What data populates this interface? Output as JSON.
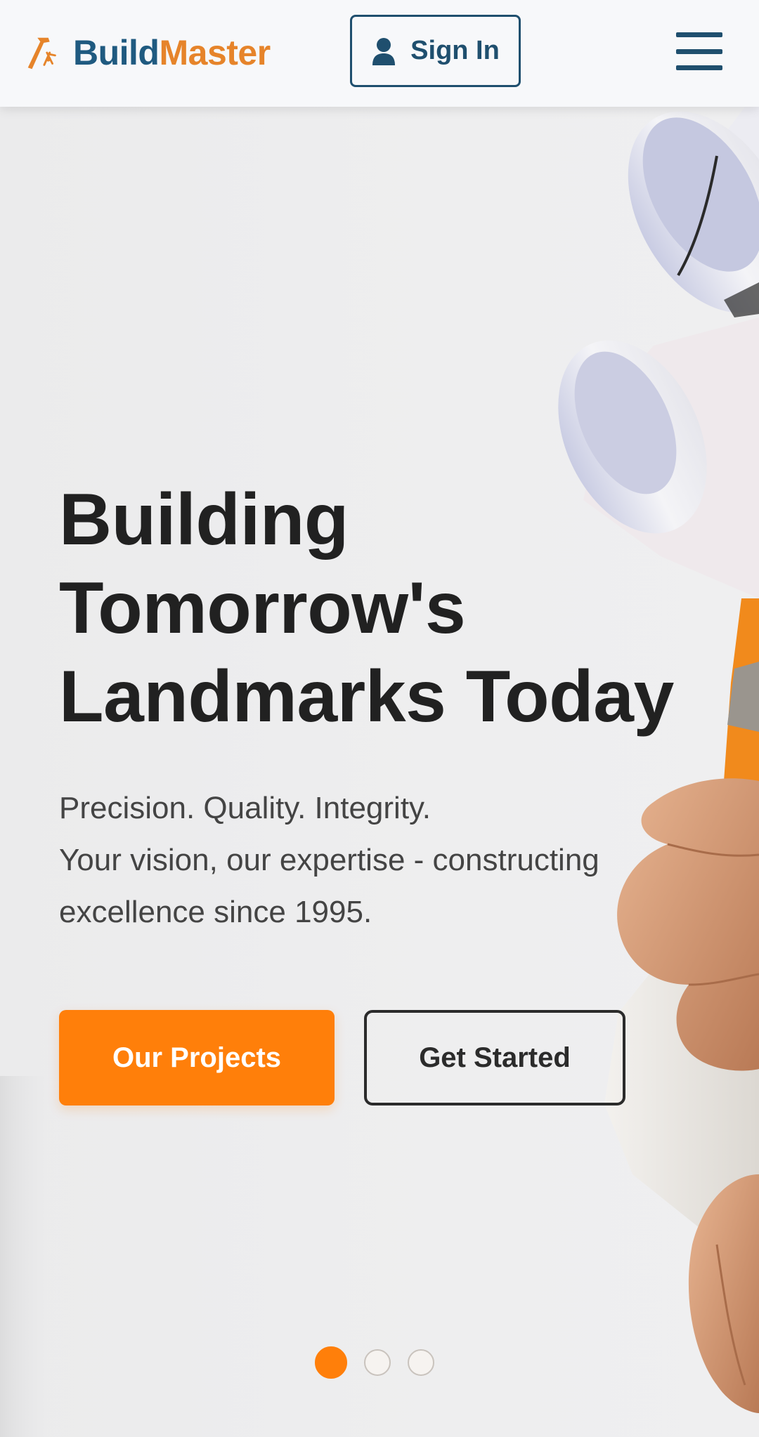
{
  "header": {
    "brand_part1": "Build",
    "brand_part2": "Master",
    "brand_icon": "hammer-icon",
    "signin_icon": "user-icon",
    "signin_label": "Sign In",
    "menu_icon": "hamburger-menu-icon"
  },
  "hero": {
    "title_line1": "Building",
    "title_line2": "Tomorrow's",
    "title_line3": "Landmarks Today",
    "sub_line1": "Precision. Quality. Integrity.",
    "sub_line2": "Your vision, our expertise - constructing excellence since 1995.",
    "primary_button": "Our Projects",
    "secondary_button": "Get Started"
  },
  "carousel": {
    "slides": 3,
    "active_index": 0
  },
  "colors": {
    "brand_blue": "#1f5a80",
    "brand_orange": "#e6842a",
    "accent_orange": "#ff7f0a",
    "text_dark": "#212121"
  }
}
